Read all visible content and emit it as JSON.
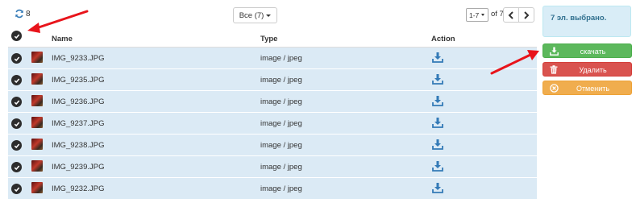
{
  "toolbar": {
    "refresh_icon": "refresh-icon",
    "refresh_count": "8",
    "filter_label": "Все (7)",
    "pager_range": "1-7",
    "pager_of": "of 7"
  },
  "table": {
    "headers": {
      "name": "Name",
      "type": "Type",
      "action": "Action"
    },
    "rows": [
      {
        "name": "IMG_9233.JPG",
        "type": "image / jpeg"
      },
      {
        "name": "IMG_9235.JPG",
        "type": "image / jpeg"
      },
      {
        "name": "IMG_9236.JPG",
        "type": "image / jpeg"
      },
      {
        "name": "IMG_9237.JPG",
        "type": "image / jpeg"
      },
      {
        "name": "IMG_9238.JPG",
        "type": "image / jpeg"
      },
      {
        "name": "IMG_9239.JPG",
        "type": "image / jpeg"
      },
      {
        "name": "IMG_9232.JPG",
        "type": "image / jpeg"
      }
    ]
  },
  "panel": {
    "selected_text": "7 эл. выбрано.",
    "download_label": "скачать",
    "delete_label": "Удалить",
    "cancel_label": "Отменить"
  },
  "colors": {
    "row_bg": "#dbeaf5",
    "download": "#5cb85c",
    "delete": "#d9534f",
    "cancel": "#f0ad4e",
    "link": "#337ab7",
    "annotation_arrow": "#e8141b"
  }
}
